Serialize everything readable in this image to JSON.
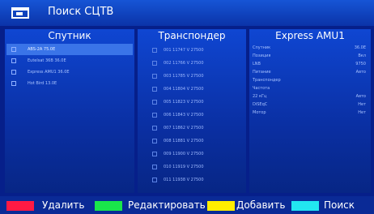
{
  "header": {
    "title": "Поиск СЦТВ",
    "icon": "tv-icon"
  },
  "panels": {
    "satellite": {
      "title": "Спутник",
      "items": [
        {
          "label": "ABS-2A 75.0E",
          "selected": true
        },
        {
          "label": "Eutelsat 36B 36.0E",
          "selected": false
        },
        {
          "label": "Express AMU1 36.0E",
          "selected": false
        },
        {
          "label": "Hot Bird 13.0E",
          "selected": false
        }
      ]
    },
    "transponder": {
      "title": "Транспондер",
      "rows": [
        "001 11747 V 27500",
        "002 11766 V 27500",
        "003 11785 V 27500",
        "004 11804 V 27500",
        "005 11823 V 27500",
        "006 11843 V 27500",
        "007 11862 V 27500",
        "008 11881 V 27500",
        "009 11900 V 27500",
        "010 11919 V 27500",
        "011 11938 V 27500"
      ]
    },
    "info": {
      "title": "Express AMU1",
      "rows": [
        {
          "label": "Спутник",
          "value": "36.0E"
        },
        {
          "label": "Позиция",
          "value": "Вкл"
        },
        {
          "label": "LNB",
          "value": "9750"
        },
        {
          "label": "Питание",
          "value": "Авто"
        },
        {
          "label": "Транспондер",
          "value": ""
        },
        {
          "label": "Частота",
          "value": ""
        },
        {
          "label": "22 кГц",
          "value": "Авто"
        },
        {
          "label": "DiSEqC",
          "value": "Нет"
        },
        {
          "label": "Мотор",
          "value": "Нет"
        }
      ]
    }
  },
  "footer": {
    "keys": [
      {
        "color": "#ff1a44",
        "label": "Удалить"
      },
      {
        "color": "#19e64a",
        "label": "Редактировать"
      },
      {
        "color": "#ffee00",
        "label": "Добавить"
      },
      {
        "color": "#22e6f0",
        "label": "Поиск"
      }
    ]
  }
}
